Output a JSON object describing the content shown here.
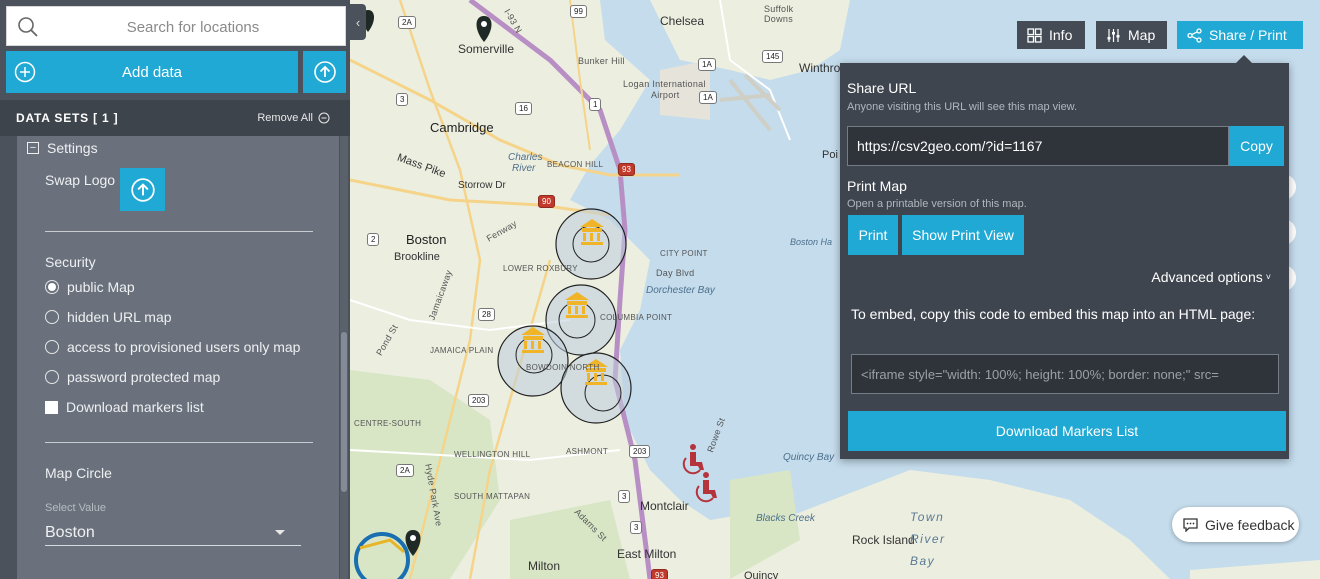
{
  "sidebar": {
    "search": {
      "placeholder": "Search for locations"
    },
    "add_data_label": "Add data",
    "datasets": {
      "title": "DATA SETS   [ 1 ]",
      "remove_all": "Remove All"
    },
    "settings": {
      "heading": "Settings",
      "swap_logo_label": "Swap Logo",
      "security_title": "Security",
      "security_options": [
        {
          "label": "public Map",
          "selected": true
        },
        {
          "label": "hidden URL map",
          "selected": false
        },
        {
          "label": "access to provisioned users only map",
          "selected": false
        },
        {
          "label": "password protected map",
          "selected": false
        }
      ],
      "download_markers_label": "Download markers list",
      "map_circle_title": "Map Circle",
      "select_label": "Select Value",
      "select_value": "Boston"
    }
  },
  "toolbar": {
    "info": "Info",
    "map": "Map",
    "share_print": "Share / Print"
  },
  "share_popup": {
    "share_url_title": "Share URL",
    "share_url_sub": "Anyone visiting this URL will see this map view.",
    "url": "https://csv2geo.com/?id=1167",
    "copy": "Copy",
    "print_title": "Print Map",
    "print_sub": "Open a printable version of this map.",
    "print": "Print",
    "show_print_view": "Show Print View",
    "advanced": "Advanced options",
    "embed_text": "To embed, copy this code to embed this map into an HTML page:",
    "embed_code": "<iframe style=\"width: 100%; height: 100%; border: none;\" src=",
    "download_markers": "Download Markers List"
  },
  "feedback": "Give feedback",
  "map_labels": {
    "somerville": "Somerville",
    "chelsea": "Chelsea",
    "winthrop": "Winthro",
    "suffolk": "Suffolk",
    "downs": "Downs",
    "cambridge": "Cambridge",
    "bunker_hill": "Bunker Hill",
    "logan": "Logan International",
    "airport": "Airport",
    "charles_river": "Charles",
    "river": "River",
    "beacon_hill": "BEACON HILL",
    "mass_pike": "Mass Pike",
    "storrow": "Storrow Dr",
    "boston": "Boston",
    "brookline": "Brookline",
    "fenway": "Fenway",
    "lower_roxbury": "LOWER ROXBURY",
    "city_point": "CITY POINT",
    "day_blvd": "Day Blvd",
    "dorchester_bay": "Dorchester Bay",
    "boston_harbor": "Boston Ha",
    "poi": "Poi",
    "columbia_point": "COLUMBIA POINT",
    "jamaica_plain": "JAMAICA PLAIN",
    "jamaicaway": "Jamaicaway",
    "bowdoin_north": "BOWDOIN NORTH",
    "pond_st": "Pond St",
    "centre_south": "CENTRE-SOUTH",
    "wellington_hill": "WELLINGTON HILL",
    "ashmont": "ASHMONT",
    "quincy_bay": "Quincy Bay",
    "south_mattapan": "SOUTH MATTAPAN",
    "montclair": "Montclair",
    "blacks_creek": "Blacks Creek",
    "rock_island": "Rock Island",
    "town_river_bay": "Town River Bay",
    "east_milton": "East Milton",
    "milton": "Milton",
    "quincy": "Quincy",
    "hyde_park_ave": "Hyde Park Ave",
    "rowe_st": "Rowe St",
    "adams_st": "Adams St",
    "i93": "I-93 N",
    "shields": [
      "2A",
      "99",
      "16",
      "1A",
      "145",
      "1",
      "3",
      "2",
      "90",
      "93",
      "28",
      "203",
      "3",
      "203",
      "2A",
      "3",
      "93",
      "1A"
    ]
  },
  "colors": {
    "accent": "#1fa9d4",
    "sidebar": "#4b525c",
    "panel": "#6a717c",
    "popup": "#3f454e",
    "marker": "#f0b429",
    "map_water": "#c4dcec",
    "map_land": "#eef0e4"
  }
}
